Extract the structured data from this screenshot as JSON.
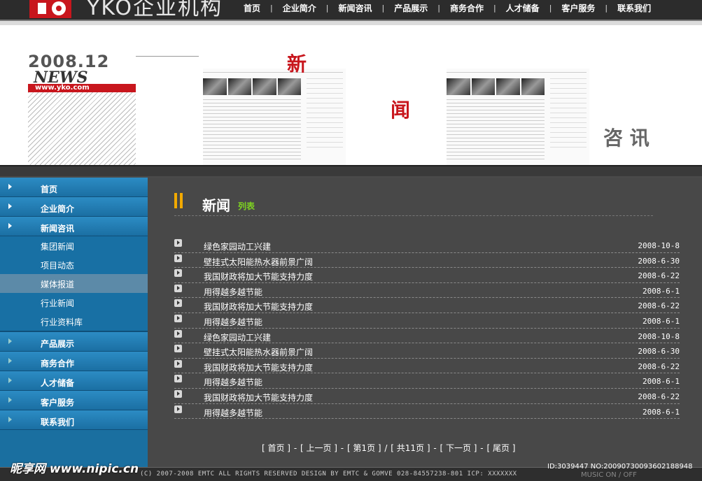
{
  "brand": {
    "name": "YKO企业机构"
  },
  "nav": [
    "首页",
    "企业简介",
    "新闻咨讯",
    "产品展示",
    "商务合作",
    "人才储备",
    "客户服务",
    "联系我们"
  ],
  "banner": {
    "year": "2008.12",
    "word": "NEWS",
    "url": "www.yko.com",
    "chars": [
      "新",
      "闻",
      "咨 讯"
    ]
  },
  "sidebar": {
    "items_top": [
      "首页",
      "企业简介",
      "新闻咨讯"
    ],
    "sub_items": [
      "集团新闻",
      "项目动态",
      "媒体报道",
      "行业新闻",
      "行业资料库"
    ],
    "active_sub": "媒体报道",
    "items_bottom": [
      "产品展示",
      "商务合作",
      "人才储备",
      "客户服务",
      "联系我们"
    ]
  },
  "main": {
    "title": "新闻",
    "subtitle": "列表",
    "news": [
      {
        "title": "绿色家园动工兴建",
        "date": "2008-10-8"
      },
      {
        "title": "壁挂式太阳能热水器前景广阔",
        "date": "2008-6-30"
      },
      {
        "title": "我国财政将加大节能支持力度",
        "date": "2008-6-22"
      },
      {
        "title": "用得越多越节能",
        "date": "2008-6-1"
      },
      {
        "title": "我国财政将加大节能支持力度",
        "date": "2008-6-22"
      },
      {
        "title": "用得越多越节能",
        "date": "2008-6-1"
      },
      {
        "title": "绿色家园动工兴建",
        "date": "2008-10-8"
      },
      {
        "title": "壁挂式太阳能热水器前景广阔",
        "date": "2008-6-30"
      },
      {
        "title": "我国财政将加大节能支持力度",
        "date": "2008-6-22"
      },
      {
        "title": "用得越多越节能",
        "date": "2008-6-1"
      },
      {
        "title": "我国财政将加大节能支持力度",
        "date": "2008-6-22"
      },
      {
        "title": "用得越多越节能",
        "date": "2008-6-1"
      }
    ],
    "pager": {
      "first": "[ 首页 ]",
      "prev": "[ 上一页 ]",
      "page": "[ 第1页 ]",
      "total": "[ 共11页 ]",
      "next": "[ 下一页 ]",
      "last": "[ 尾页 ]"
    }
  },
  "footer": {
    "text": "(C) 2007-2008 EMTC ALL RIGHTS RESERVED    DESIGN BY EMTC & GOMVE    028-84557238-801    ICP: XXXXXXX"
  },
  "overlay": {
    "watermark": "昵享网 www.nipic.cn",
    "id": "ID:3039447 NO:20090730093602188948",
    "music": "MUSIC    ON / OFF"
  }
}
